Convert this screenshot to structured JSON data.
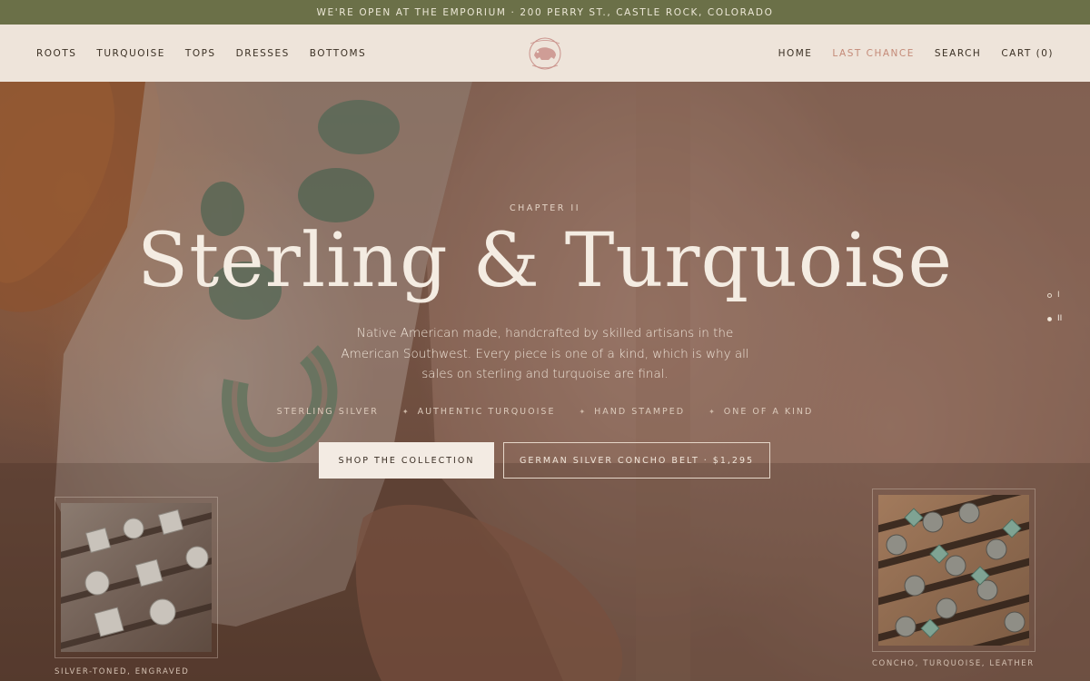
{
  "announcement": {
    "text": "WE'RE OPEN AT THE EMPORIUM · 200 PERRY ST., CASTLE ROCK, COLORADO"
  },
  "nav": {
    "left": [
      {
        "label": "ROOTS"
      },
      {
        "label": "TURQUOISE"
      },
      {
        "label": "TOPS"
      },
      {
        "label": "DRESSES"
      },
      {
        "label": "BOTTOMS"
      }
    ],
    "right": [
      {
        "label": "HOME"
      },
      {
        "label": "LAST CHANCE"
      },
      {
        "label": "SEARCH"
      },
      {
        "label": "CART (0)"
      }
    ],
    "logo_icon": "buffalo-seal-logo"
  },
  "hero": {
    "chapter": "CHAPTER II",
    "headline": "Sterling & Turquoise",
    "subcopy": "Native American made, handcrafted by skilled artisans in the American Southwest. Every piece is one of a kind, which is why all sales on sterling and turquoise are final.",
    "features": [
      "STERLING SILVER",
      "AUTHENTIC TURQUOISE",
      "HAND STAMPED",
      "ONE OF A KIND"
    ],
    "primary_cta": "SHOP THE COLLECTION",
    "secondary_cta": "GERMAN SILVER CONCHO BELT · $1,295",
    "slides": [
      {
        "label": "I",
        "active": false
      },
      {
        "label": "II",
        "active": true
      }
    ]
  },
  "thumbnails": {
    "left_caption": "SILVER-TONED, ENGRAVED",
    "right_caption": "CONCHO, TURQUOISE, LEATHER"
  },
  "colors": {
    "announcement_bg": "#6b7048",
    "nav_bg": "#eee4da",
    "accent": "#c48a78",
    "turquoise": "#6f9a82"
  }
}
